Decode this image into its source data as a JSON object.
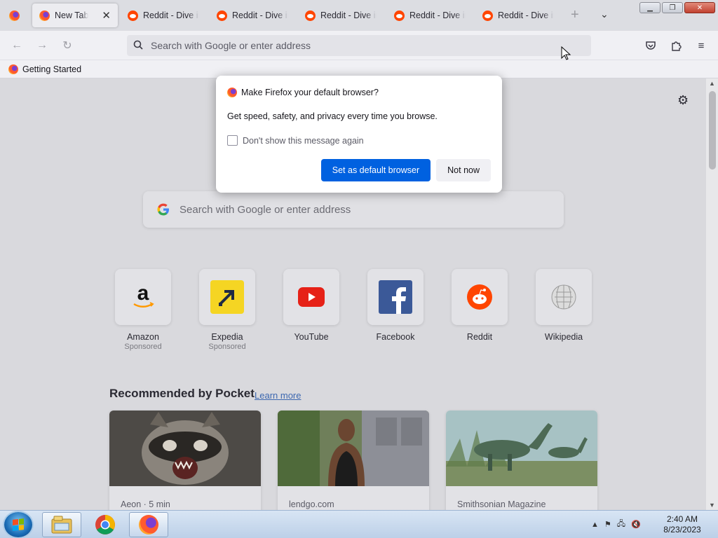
{
  "browser": {
    "tabs": [
      {
        "label": "New Tab",
        "active": true,
        "icon": "firefox-icon"
      },
      {
        "label": "Reddit - Dive into anything",
        "active": false,
        "icon": "reddit-icon"
      },
      {
        "label": "Reddit - Dive into anything",
        "active": false,
        "icon": "reddit-icon"
      },
      {
        "label": "Reddit - Dive into anything",
        "active": false,
        "icon": "reddit-icon"
      },
      {
        "label": "Reddit - Dive into anything",
        "active": false,
        "icon": "reddit-icon"
      },
      {
        "label": "Reddit - Dive into anything",
        "active": false,
        "icon": "reddit-icon"
      }
    ],
    "urlbar_placeholder": "Search with Google or enter address",
    "bookmarks": [
      {
        "label": "Getting Started",
        "icon": "firefox-icon"
      }
    ]
  },
  "newtab": {
    "search_placeholder": "Search with Google or enter address",
    "top_sites": [
      {
        "name": "Amazon",
        "sub": "Sponsored",
        "icon": "amazon-icon"
      },
      {
        "name": "Expedia",
        "sub": "Sponsored",
        "icon": "expedia-icon"
      },
      {
        "name": "YouTube",
        "sub": "",
        "icon": "youtube-icon"
      },
      {
        "name": "Facebook",
        "sub": "",
        "icon": "facebook-icon"
      },
      {
        "name": "Reddit",
        "sub": "",
        "icon": "reddit-icon"
      },
      {
        "name": "Wikipedia",
        "sub": "",
        "icon": "wikipedia-icon"
      }
    ],
    "pocket": {
      "title": "Recommended by Pocket",
      "learn_more": "Learn more",
      "cards": [
        {
          "source": "Aeon · 5 min",
          "image": "raccoon-photo"
        },
        {
          "source": "lendgo.com",
          "image": "woman-photo"
        },
        {
          "source": "Smithsonian Magazine",
          "image": "dinosaur-photo"
        }
      ]
    }
  },
  "dialog": {
    "title": "Make Firefox your default browser?",
    "body": "Get speed, safety, and privacy every time you browse.",
    "checkbox_label": "Don't show this message again",
    "checkbox_checked": false,
    "primary_button": "Set as default browser",
    "secondary_button": "Not now"
  },
  "taskbar": {
    "apps": [
      "file-explorer-icon",
      "chrome-icon",
      "firefox-icon"
    ],
    "time": "2:40 AM",
    "date": "8/23/2023"
  },
  "colors": {
    "primary_button": "#0061e0",
    "reddit": "#ff4500"
  }
}
